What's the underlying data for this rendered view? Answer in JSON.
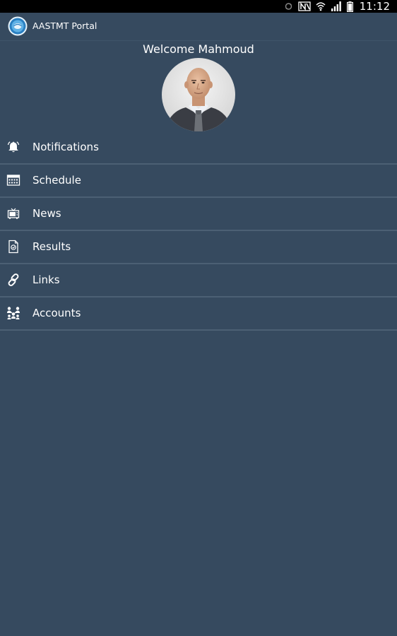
{
  "status_bar": {
    "time": "11:12",
    "icons": [
      "sync-icon",
      "nfc-icon",
      "wifi-icon",
      "signal-icon",
      "battery-icon"
    ]
  },
  "app": {
    "title": "AASTMT Portal",
    "logo": "aastmt-logo"
  },
  "profile": {
    "welcome": "Welcome Mahmoud"
  },
  "menu": {
    "items": [
      {
        "label": "Notifications",
        "icon": "bell-icon"
      },
      {
        "label": "Schedule",
        "icon": "calendar-icon"
      },
      {
        "label": "News",
        "icon": "tv-icon"
      },
      {
        "label": "Results",
        "icon": "document-icon"
      },
      {
        "label": "Links",
        "icon": "link-icon"
      },
      {
        "label": "Accounts",
        "icon": "accounts-icon"
      }
    ]
  },
  "colors": {
    "background": "#364a5f",
    "divider": "#4c6074",
    "status_bar": "#000000",
    "text": "#ffffff"
  }
}
